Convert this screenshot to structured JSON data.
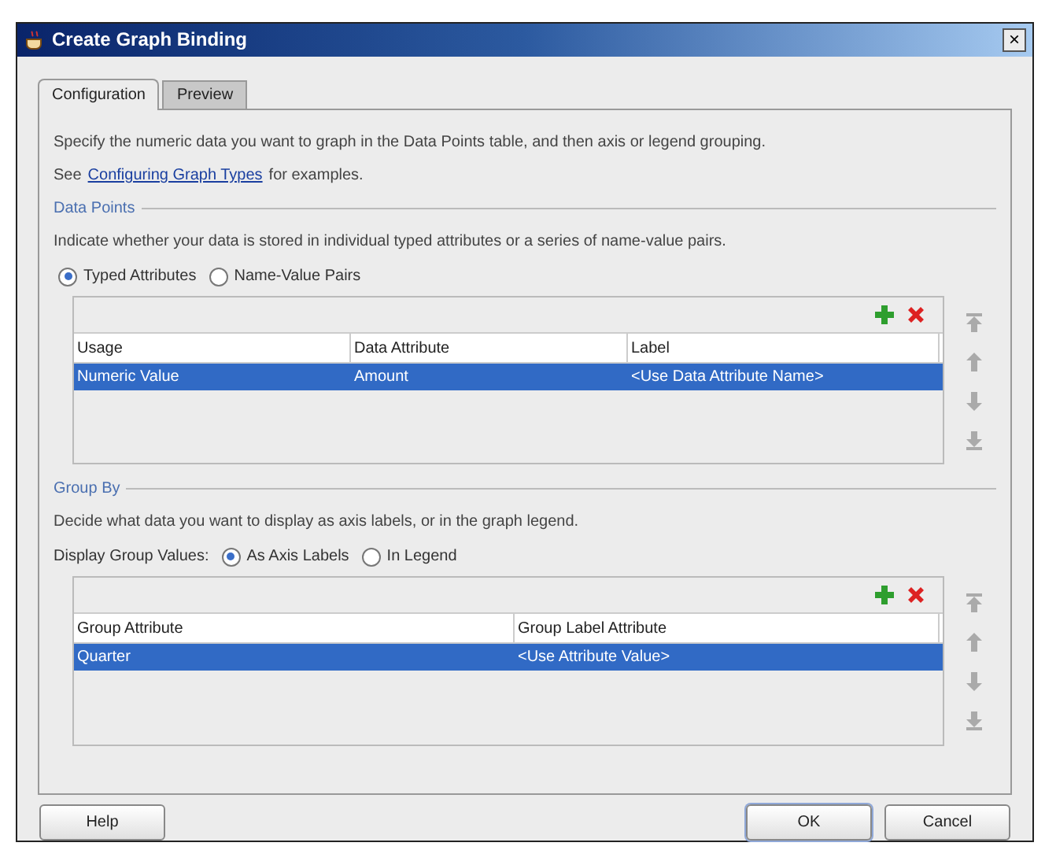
{
  "window": {
    "title": "Create Graph Binding",
    "close": "×"
  },
  "tabs": [
    {
      "label": "Configuration",
      "selected": true
    },
    {
      "label": "Preview",
      "selected": false
    }
  ],
  "intro": {
    "text": "Specify the numeric data you want to graph in the Data Points table, and then axis or legend grouping.",
    "see_prefix": "See",
    "link": "Configuring Graph Types",
    "see_suffix": "for examples."
  },
  "data_points": {
    "heading": "Data Points",
    "description": "Indicate whether your data is stored in individual typed attributes or a series of name-value pairs.",
    "options": [
      {
        "label": "Typed Attributes",
        "selected": true
      },
      {
        "label": "Name-Value Pairs",
        "selected": false
      }
    ],
    "table": {
      "columns": [
        "Usage",
        "Data Attribute",
        "Label"
      ],
      "rows": [
        {
          "cells": [
            "Numeric Value",
            "Amount",
            "<Use Data Attribute Name>"
          ],
          "selected": true
        }
      ]
    }
  },
  "group_by": {
    "heading": "Group By",
    "description": "Decide what data you want to display as axis labels, or in the graph legend.",
    "options_label": "Display Group Values:",
    "options": [
      {
        "label": "As Axis Labels",
        "selected": true
      },
      {
        "label": "In Legend",
        "selected": false
      }
    ],
    "table": {
      "columns": [
        "Group Attribute",
        "Group Label Attribute"
      ],
      "rows": [
        {
          "cells": [
            "Quarter",
            "<Use Attribute Value>"
          ],
          "selected": true
        }
      ]
    }
  },
  "buttons": [
    {
      "label": "Help",
      "kind": "help"
    },
    {
      "label": "OK",
      "kind": "default"
    },
    {
      "label": "Cancel",
      "kind": "normal"
    }
  ]
}
